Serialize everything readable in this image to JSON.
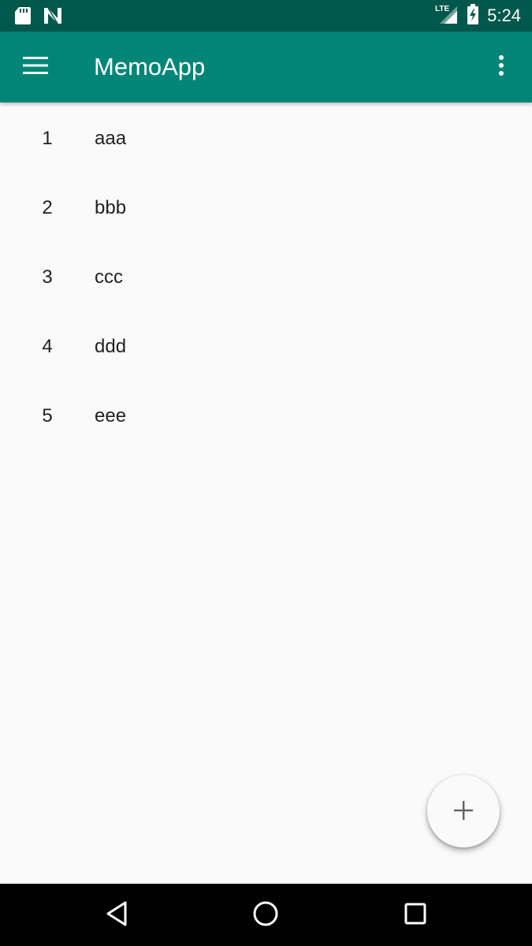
{
  "status_bar": {
    "network_label": "LTE",
    "time": "5:24",
    "icons": [
      "sd-card-icon",
      "n-logo-icon",
      "signal-icon",
      "battery-charging-icon"
    ]
  },
  "app_bar": {
    "title": "MemoApp",
    "icons": [
      "menu-icon",
      "overflow-menu-icon"
    ]
  },
  "memos": [
    {
      "id": "1",
      "text": "aaa"
    },
    {
      "id": "2",
      "text": "bbb"
    },
    {
      "id": "3",
      "text": "ccc"
    },
    {
      "id": "4",
      "text": "ddd"
    },
    {
      "id": "5",
      "text": "eee"
    }
  ],
  "fab": {
    "icon": "add-icon"
  },
  "nav_bar": {
    "icons": [
      "back-icon",
      "home-icon",
      "recents-icon"
    ]
  },
  "colors": {
    "status_bar": "#00574b",
    "app_bar": "#008577",
    "background": "#fafafa",
    "text": "#212121"
  }
}
